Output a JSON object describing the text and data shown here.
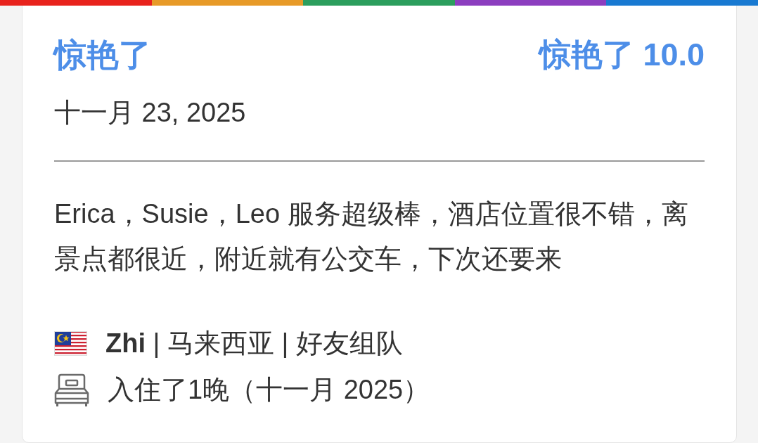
{
  "color_stripe": [
    {
      "color": "#e8221c"
    },
    {
      "color": "#e79a28"
    },
    {
      "color": "#2c9e5d"
    },
    {
      "color": "#8c3ebf"
    },
    {
      "color": "#1879d1"
    }
  ],
  "review": {
    "rating_label": "惊艳了",
    "score": "惊艳了 10.0",
    "date": "十一月 23, 2025",
    "text": "Erica，Susie，Leo 服务超级棒，酒店位置很不错，离景点都很近，附近就有公交车，下次还要来",
    "reviewer": "**Zhi** | 马来西亚 | 好友组队",
    "stay": "入住了1晚（十一月 2025）"
  }
}
